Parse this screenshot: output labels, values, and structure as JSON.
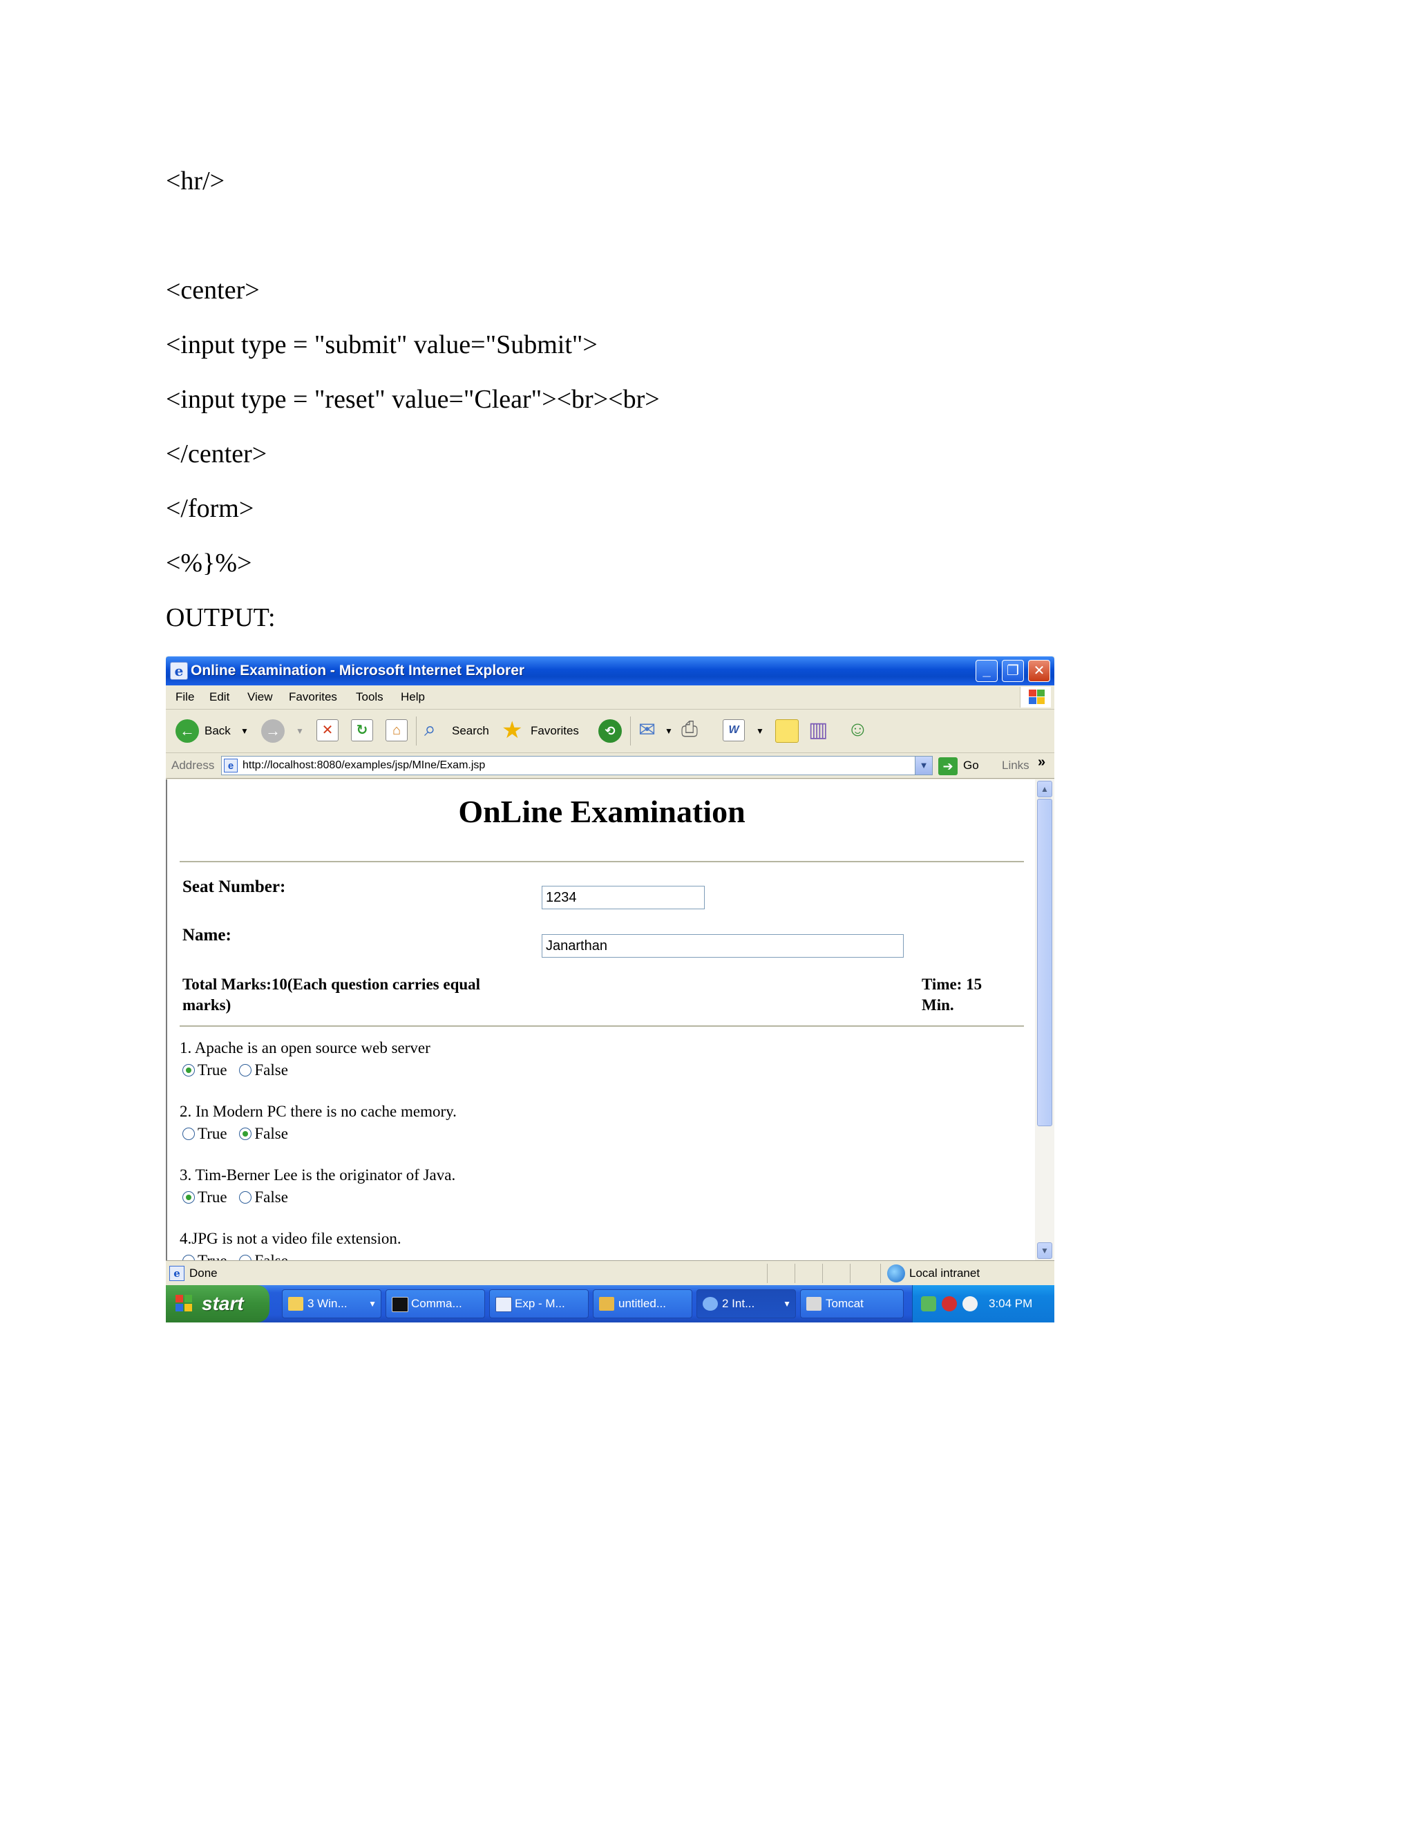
{
  "code_lines": [
    "<hr/>",
    "<center>",
    "<input type = \"submit\" value=\"Submit\">",
    "<input type = \"reset\" value=\"Clear\"><br><br>",
    "</center>",
    "</form>",
    "<%}%>"
  ],
  "output_label": "OUTPUT:",
  "browser": {
    "window_title": "Online Examination - Microsoft Internet Explorer",
    "menu": [
      "File",
      "Edit",
      "View",
      "Favorites",
      "Tools",
      "Help"
    ],
    "toolbar": {
      "back": "Back",
      "search": "Search",
      "favorites": "Favorites"
    },
    "address_label": "Address",
    "url": "http://localhost:8080/examples/jsp/MIne/Exam.jsp",
    "go": "Go",
    "links": "Links",
    "status_text": "Done",
    "status_zone": "Local intranet"
  },
  "page": {
    "title": "OnLine Examination",
    "seat_label": "Seat Number:",
    "seat_value": "1234",
    "name_label": "Name:",
    "name_value": "Janarthan",
    "total_marks": "Total Marks:10(Each question carries equal marks)",
    "time": "Time: 15 Min.",
    "questions": [
      {
        "text": "1. Apache is an open source web server",
        "selected": "True"
      },
      {
        "text": "2. In Modern PC there is no cache memory.",
        "selected": "False"
      },
      {
        "text": "3. Tim-Berner Lee is the originator of Java.",
        "selected": "True"
      },
      {
        "text": "4.JPG is not a video file extension.",
        "selected": ""
      }
    ],
    "option_true": "True",
    "option_false": "False"
  },
  "taskbar": {
    "start": "start",
    "tasks": [
      "3 Win...",
      "Comma...",
      "Exp - M...",
      "untitled...",
      "2 Int...",
      "Tomcat"
    ],
    "clock": "3:04 PM"
  }
}
